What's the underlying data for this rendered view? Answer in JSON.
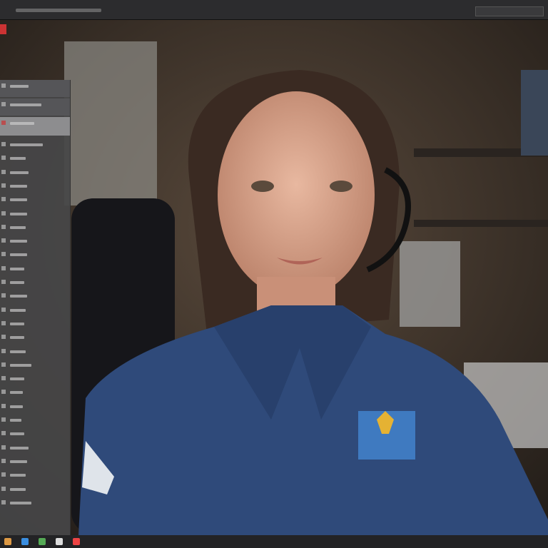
{
  "window": {
    "icon": "app-icon",
    "accent": "#cc3333"
  },
  "sidebar": {
    "items": [
      {
        "icon": "folder-icon"
      },
      {
        "icon": "folder-icon"
      },
      {
        "icon": "record-icon"
      },
      {
        "icon": "item-icon"
      },
      {
        "icon": "item-icon"
      },
      {
        "icon": "item-icon"
      },
      {
        "icon": "item-icon"
      },
      {
        "icon": "item-icon"
      },
      {
        "icon": "item-icon"
      },
      {
        "icon": "item-icon"
      },
      {
        "icon": "item-icon"
      },
      {
        "icon": "item-icon"
      },
      {
        "icon": "item-icon"
      },
      {
        "icon": "item-icon"
      },
      {
        "icon": "item-icon"
      },
      {
        "icon": "item-icon"
      },
      {
        "icon": "item-icon"
      },
      {
        "icon": "item-icon"
      },
      {
        "icon": "item-icon"
      },
      {
        "icon": "item-icon"
      },
      {
        "icon": "item-icon"
      },
      {
        "icon": "item-icon"
      },
      {
        "icon": "item-icon"
      },
      {
        "icon": "item-icon"
      },
      {
        "icon": "item-icon"
      },
      {
        "icon": "item-icon"
      },
      {
        "icon": "item-icon"
      },
      {
        "icon": "item-icon"
      },
      {
        "icon": "item-icon"
      },
      {
        "icon": "item-icon"
      }
    ]
  },
  "taskbar": {
    "icons": [
      "start-icon",
      "browser-icon",
      "files-icon",
      "mail-icon",
      "app-icon"
    ]
  },
  "colors": {
    "uniform": "#2f4a7a",
    "sidebar": "#464648",
    "titlebar": "#2c2c2e"
  }
}
